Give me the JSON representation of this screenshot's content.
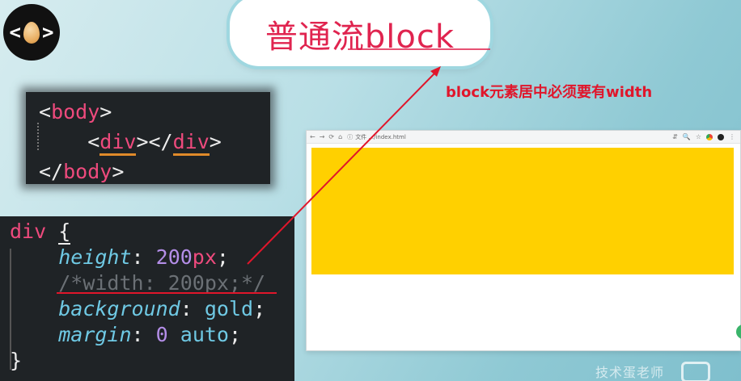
{
  "title": "普通流block",
  "annotation": "block元素居中必须要有width",
  "html_code": {
    "line1": {
      "open": "<",
      "tag": "body",
      "close": ">"
    },
    "line2": {
      "indent": "    ",
      "open": "<",
      "tag1": "div",
      "mid": "></",
      "tag2": "div",
      "close": ">"
    },
    "line3": {
      "open": "</",
      "tag": "body",
      "close": ">"
    }
  },
  "css_code": {
    "selector": "div",
    "open_brace": "{",
    "close_brace": "}",
    "decl1": {
      "prop": "height",
      "num": "200",
      "unit": "px",
      "end": ";"
    },
    "decl2": {
      "comment": "/*width: 200px;*/"
    },
    "decl3": {
      "prop": "background",
      "value": "gold",
      "end": ";"
    },
    "decl4": {
      "prop": "margin",
      "num": "0",
      "value": "auto",
      "end": ";"
    }
  },
  "browser": {
    "address": "文件  .../index.html",
    "nav_icons": [
      "←",
      "→",
      "⟳",
      "⌂",
      "ⓘ"
    ],
    "right_icons": [
      "⇵",
      "🔍",
      "☆",
      "⋮"
    ],
    "box_color": "#ffd000"
  },
  "watermark": "技术蛋老师",
  "colors": {
    "accent_red": "#e0162b",
    "title_pink": "#e0244f",
    "gold": "#ffd000"
  },
  "icons": {
    "logo": "egg-logo-icon",
    "tv": "tv-icon"
  }
}
